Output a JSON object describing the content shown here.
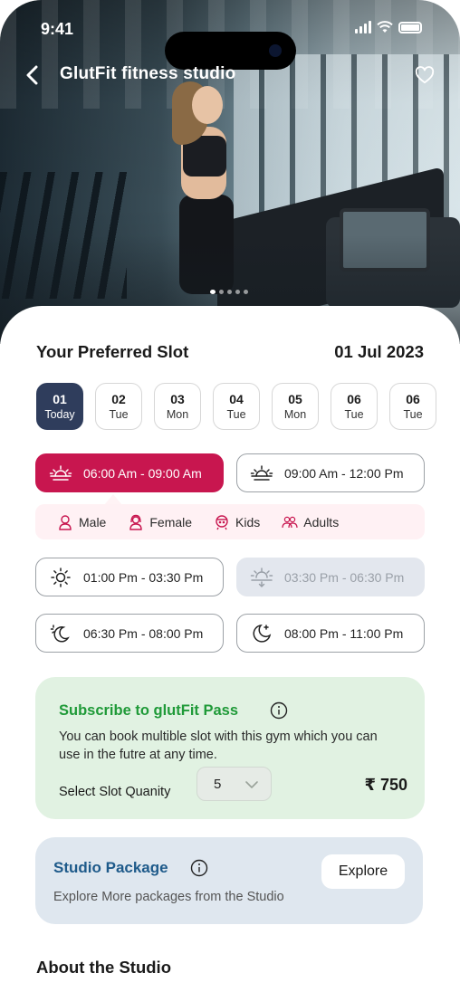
{
  "status_bar": {
    "time": "9:41"
  },
  "header": {
    "title": "GlutFit fitness studio",
    "back_icon": "chevron-left-icon",
    "favorite_icon": "heart-outline-icon"
  },
  "carousel": {
    "count": 5,
    "active_index": 0
  },
  "slot": {
    "title": "Your Preferred Slot",
    "date": "01 Jul 2023",
    "days": [
      {
        "num": "01",
        "label": "Today",
        "selected": true
      },
      {
        "num": "02",
        "label": "Tue",
        "selected": false
      },
      {
        "num": "03",
        "label": "Mon",
        "selected": false
      },
      {
        "num": "04",
        "label": "Tue",
        "selected": false
      },
      {
        "num": "05",
        "label": "Mon",
        "selected": false
      },
      {
        "num": "06",
        "label": "Tue",
        "selected": false
      },
      {
        "num": "06",
        "label": "Tue",
        "selected": false
      }
    ],
    "times": [
      {
        "label": "06:00 Am - 09:00 Am",
        "icon": "sunrise-icon",
        "state": "selected"
      },
      {
        "label": "09:00 Am - 12:00 Pm",
        "icon": "sunrise-icon",
        "state": "normal"
      },
      {
        "label": "01:00 Pm - 03:30 Pm",
        "icon": "sun-icon",
        "state": "normal"
      },
      {
        "label": "03:30 Pm - 06:30 Pm",
        "icon": "sunset-icon",
        "state": "disabled"
      },
      {
        "label": "06:30 Pm - 08:00 Pm",
        "icon": "moon-sun-icon",
        "state": "normal"
      },
      {
        "label": "08:00 Pm - 11:00 Pm",
        "icon": "moon-stars-icon",
        "state": "normal"
      }
    ],
    "categories": [
      {
        "label": "Male",
        "icon": "male-icon"
      },
      {
        "label": "Female",
        "icon": "female-icon"
      },
      {
        "label": "Kids",
        "icon": "kids-icon"
      },
      {
        "label": "Adults",
        "icon": "adults-icon"
      }
    ]
  },
  "pass": {
    "title": "Subscribe to glutFit Pass",
    "description": "You can book multible slot with this gym which you can use in the futre at any time.",
    "qty_label": "Select Slot Quanity",
    "qty_value": "5",
    "price": "₹ 750"
  },
  "package": {
    "title": "Studio Package",
    "description": "Explore More packages from the Studio",
    "button": "Explore"
  },
  "about": {
    "title": "About the Studio"
  },
  "colors": {
    "primary_dark": "#2f3d5c",
    "accent_pink": "#c8164f",
    "green_title": "#1f9a38",
    "blue_title": "#1e5a8a",
    "pass_bg": "#e1f2e2",
    "package_bg": "#dfe7ef",
    "category_bg": "#fff1f4"
  }
}
